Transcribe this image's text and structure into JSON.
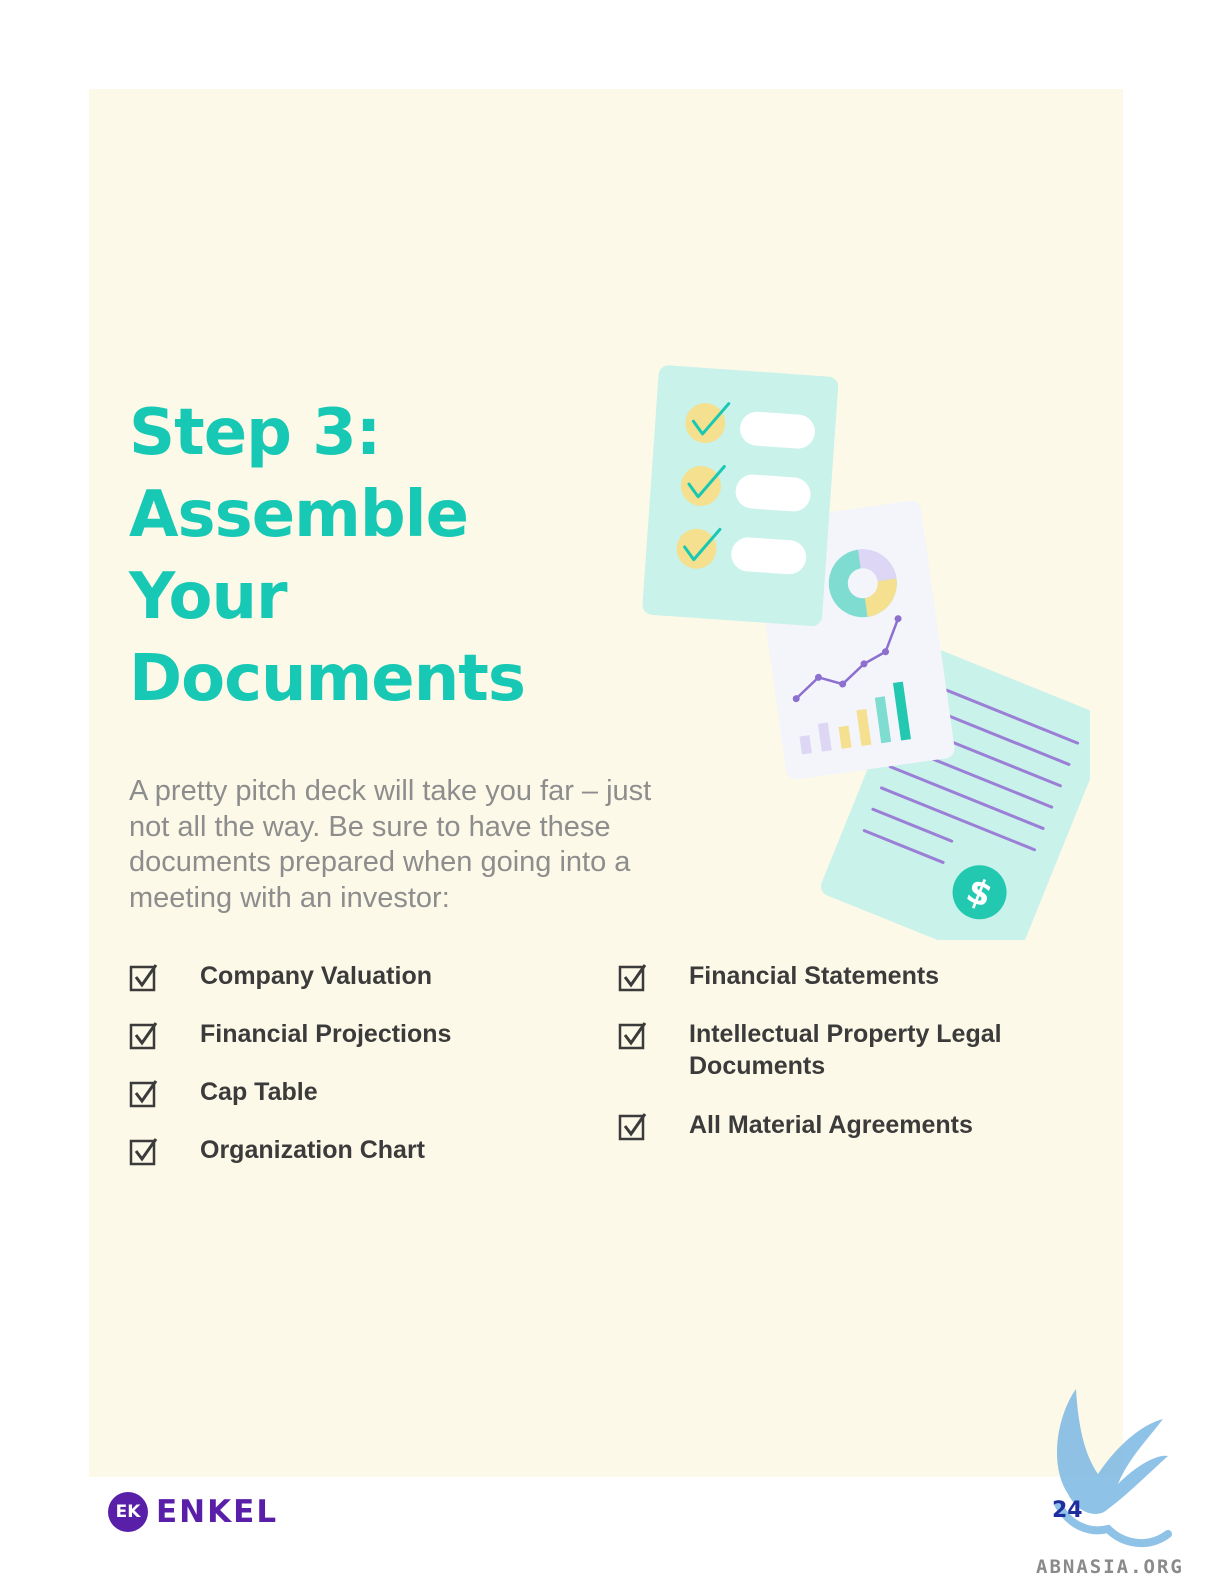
{
  "title": {
    "line1": "Step 3:",
    "line2": "Assemble",
    "line3": "Your",
    "line4": "Documents"
  },
  "intro": "A pretty pitch deck will take you far – just not all the way. Be sure to have these documents prepared when going into a meeting with an investor:",
  "checklist": {
    "left": [
      "Company Valuation",
      "Financial Projections",
      "Cap Table",
      "Organization Chart"
    ],
    "right": [
      "Financial Statements",
      "Intellectual Property Legal Documents",
      "All Material Agreements"
    ]
  },
  "footer": {
    "logo_mark": "EK",
    "logo_text": "ENKEL",
    "page_number": "24",
    "watermark_text": "ABNASIA.ORG"
  },
  "icons": {
    "checkbox": "checkbox-checked-icon",
    "illustration": "documents-illustration",
    "logo": "enkel-logo",
    "watermark": "griffin-watermark"
  },
  "colors": {
    "title": "#17c9b4",
    "background_panel": "#fdf9e8",
    "body_text": "#8d8d8d",
    "list_text": "#3b3b3b",
    "brand": "#5a1fa8"
  }
}
